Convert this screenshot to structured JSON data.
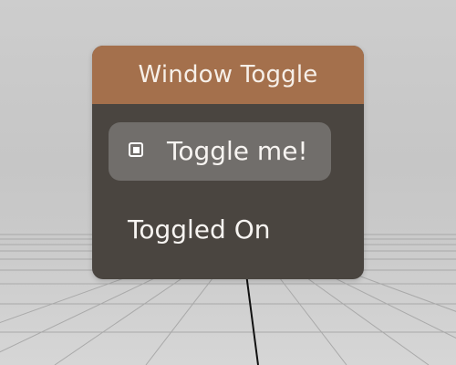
{
  "window": {
    "title": "Window Toggle",
    "toggle": {
      "label": "Toggle me!",
      "checked": true
    },
    "status_text": "Toggled On"
  },
  "colors": {
    "titlebar": "#a4704c",
    "window_body": "#4a4540",
    "button": "#716e6b",
    "text": "#f7f4f1"
  },
  "icons": {
    "toggle_state": "checkbox-checked-icon"
  }
}
